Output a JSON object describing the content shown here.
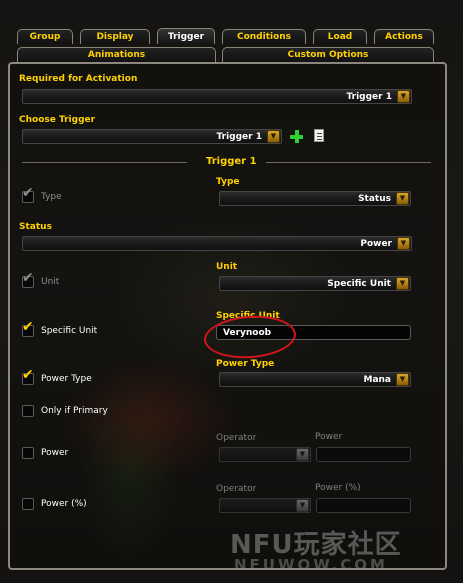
{
  "tabs_row1": [
    "Group",
    "Display",
    "Trigger",
    "Conditions",
    "Load",
    "Actions"
  ],
  "tabs_row2": [
    "Animations",
    "Custom Options"
  ],
  "active_tab": "Trigger",
  "required_for_activation": {
    "label": "Required for Activation",
    "value": "Trigger 1"
  },
  "choose_trigger": {
    "label": "Choose Trigger",
    "value": "Trigger 1"
  },
  "section_title": "Trigger 1",
  "type_row": {
    "checkbox_label": "Type",
    "dropdown_label": "Type",
    "value": "Status",
    "checked": true
  },
  "status": {
    "label": "Status",
    "value": "Power"
  },
  "unit_row": {
    "checkbox_label": "Unit",
    "dropdown_label": "Unit",
    "value": "Specific Unit",
    "checked": true
  },
  "specific_unit_row": {
    "checkbox_label": "Specific Unit",
    "field_label": "Specific Unit",
    "value": "Verynoob",
    "checked": true
  },
  "power_type_row": {
    "checkbox_label": "Power Type",
    "dropdown_label": "Power Type",
    "value": "Mana",
    "checked": true
  },
  "only_if_primary": {
    "label": "Only if Primary",
    "checked": false
  },
  "power_row": {
    "checkbox_label": "Power",
    "operator_label": "Operator",
    "value_label": "Power",
    "checked": false
  },
  "power_pct_row": {
    "checkbox_label": "Power (%)",
    "operator_label": "Operator",
    "value_label": "Power (%)",
    "checked": false
  },
  "icons": {
    "add": "plus-icon",
    "copy": "document-icon",
    "dropdown": "dropdown-arrow-icon",
    "check": "checkmark-icon"
  },
  "colors": {
    "label": "#ffd100",
    "disabled": "#7f7f7f",
    "value": "#ffffff",
    "add": "#2fd02f",
    "annotation": "#d0161c"
  },
  "watermark": {
    "line1": "NFU玩家社区",
    "line2": "NFUWOW.COM"
  }
}
